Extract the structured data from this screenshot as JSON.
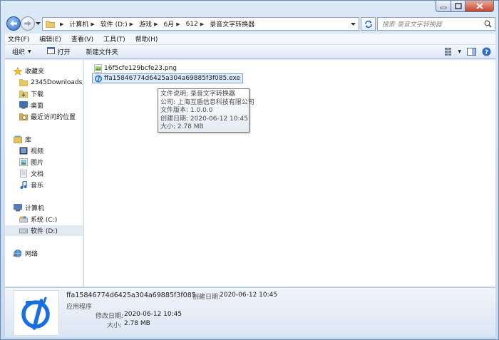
{
  "window": {
    "min_icon": "minimize-icon",
    "max_icon": "maximize-icon",
    "close_icon": "close-icon"
  },
  "address": {
    "crumbs": [
      "计算机",
      "软件 (D:)",
      "游戏",
      "6月",
      "612",
      "录音文字转换器"
    ],
    "search_placeholder": "搜索 录音文字转换器"
  },
  "menu": [
    "文件(F)",
    "编辑(E)",
    "查看(V)",
    "工具(T)",
    "帮助(H)"
  ],
  "toolbar": {
    "organize": "组织",
    "open": "打开",
    "new_folder": "新建文件夹"
  },
  "nav": {
    "favorites": "收藏夹",
    "fav_items": [
      "2345Downloads",
      "下载",
      "桌面",
      "最近访问的位置"
    ],
    "libraries": "库",
    "lib_items": [
      "视频",
      "图片",
      "文档",
      "音乐"
    ],
    "computer": "计算机",
    "drives": [
      "系统 (C:)",
      "软件 (D:)"
    ],
    "network": "网络"
  },
  "files": [
    {
      "name": "16f5cfe129bcfe23.png"
    },
    {
      "name": "ffa15846774d6425a304a69885f3f085.exe"
    }
  ],
  "tooltip": [
    "文件说明: 录音文字转换器",
    "公司: 上海互盾信息科技有限公司",
    "文件版本: 1.0.0.0",
    "创建日期: 2020-06-12 10:45",
    "大小: 2.78 MB"
  ],
  "details": {
    "name": "ffa15846774d6425a304a69885f3f085...",
    "type": "应用程序",
    "created_label": "创建日期:",
    "created_value": "2020-06-12 10:45",
    "modified_label": "修改日期:",
    "modified_value": "2020-06-12 10:45",
    "size_label": "大小:",
    "size_value": "2.78 MB"
  },
  "colors": {
    "accent": "#1a6fe0",
    "selection": "#dcebfc"
  }
}
